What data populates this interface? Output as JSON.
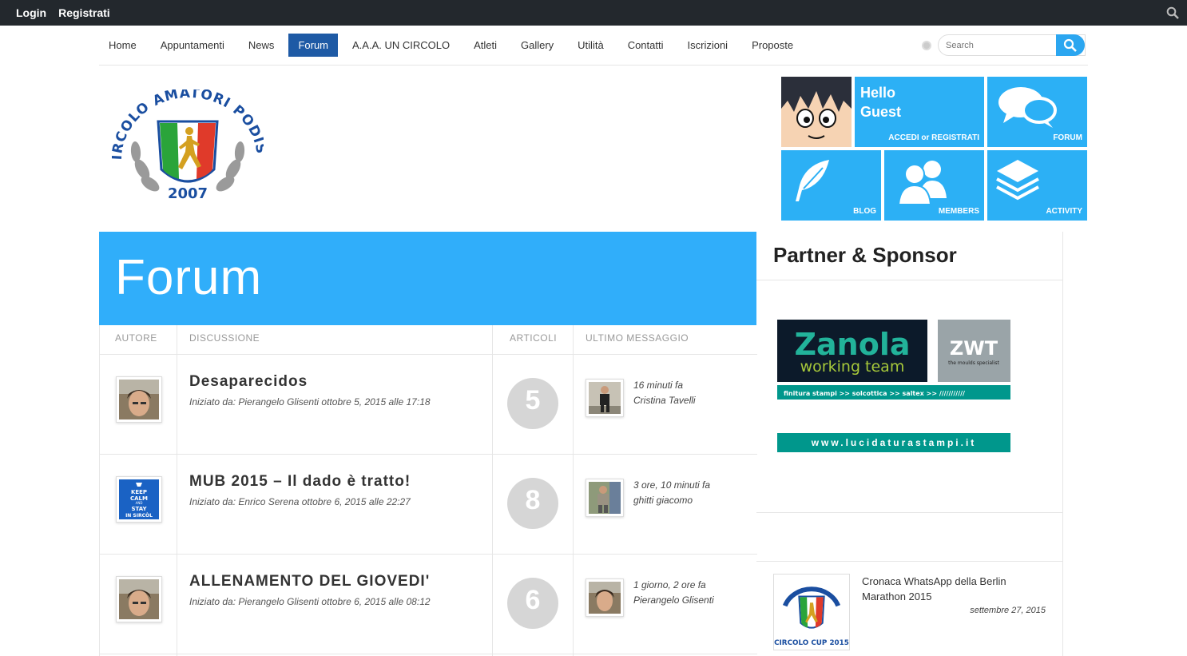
{
  "adminbar": {
    "login": "Login",
    "register": "Registrati"
  },
  "nav": {
    "items": [
      "Home",
      "Appuntamenti",
      "News",
      "Forum",
      "A.A.A. UN CIRCOLO",
      "Atleti",
      "Gallery",
      "Utilità",
      "Contatti",
      "Iscrizioni",
      "Proposte"
    ],
    "active": "Forum",
    "search_placeholder": "Search"
  },
  "logo": {
    "text": "CIRCOLO AMATORI PODISTI",
    "year": "2007"
  },
  "tiles": {
    "hello_line1": "Hello",
    "hello_line2": "Guest",
    "login_label": "ACCEDI or REGISTRATI",
    "forum": "FORUM",
    "blog": "BLOG",
    "members": "MEMBERS",
    "activity": "ACTIVITY"
  },
  "banner": {
    "title": "Forum"
  },
  "table": {
    "headers": {
      "author": "AUTORE",
      "topic": "DISCUSSIONE",
      "posts": "ARTICOLI",
      "last": "ULTIMO MESSAGGIO"
    },
    "rows": [
      {
        "title": "Desaparecidos",
        "started": "Iniziato da: Pierangelo Glisenti ottobre 5, 2015 alle 17:18",
        "count": "5",
        "last_time": "16 minuti fa",
        "last_user": "Cristina Tavelli"
      },
      {
        "title": "MUB 2015 – Il dado è tratto!",
        "started": "Iniziato da: Enrico Serena ottobre 6, 2015 alle 22:27",
        "count": "8",
        "last_time": "3 ore, 10 minuti fa",
        "last_user": "ghitti giacomo"
      },
      {
        "title": "ALLENAMENTO DEL GIOVEDI'",
        "started": "Iniziato da: Pierangelo Glisenti ottobre 6, 2015 alle 08:12",
        "count": "6",
        "last_time": "1 giorno, 2 ore fa",
        "last_user": "Pierangelo Glisenti"
      }
    ],
    "keep_calm": [
      "KEEP",
      "CALM",
      "AND",
      "STAY",
      "IN SIRCÒL"
    ]
  },
  "sidebar": {
    "title": "Partner & Sponsor",
    "sponsor_name": "Zanola",
    "sponsor_sub": "working team",
    "sponsor_mark": "ZWT",
    "sponsor_mark_sub": "the moulds specialist",
    "sponsor_strip": "finitura stampi >> solcottica >> saltex >> ///////////",
    "sponsor_url": "www.lucidaturastampi.it",
    "post": {
      "title": "Cronaca WhatsApp della Berlin Marathon 2015",
      "date": "settembre 27, 2015",
      "thumb_caption": "CIRCOLO CUP 2015"
    }
  },
  "colors": {
    "accent": "#2cb0f5",
    "nav_active": "#1e5aa5",
    "adminbar": "#23282d",
    "sponsor": "#00978c"
  }
}
